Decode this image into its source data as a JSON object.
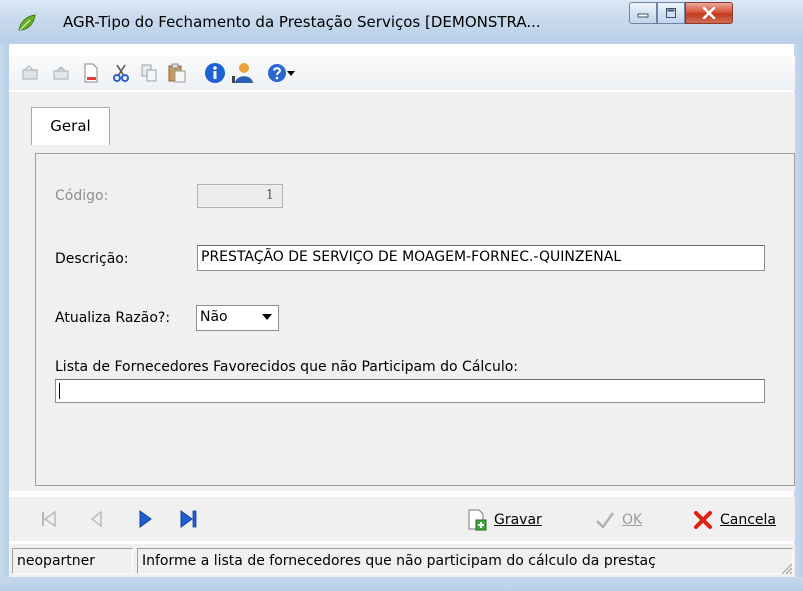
{
  "window": {
    "title": "AGR-Tipo do Fechamento da Prestação Serviços [DEMONSTRA..."
  },
  "toolbar": {
    "buttons": [
      "undo-icon",
      "redo-icon",
      "new-document-icon",
      "cut-icon",
      "copy-icon",
      "paste-icon",
      "info-icon",
      "user-icon",
      "help-icon"
    ]
  },
  "tabs": [
    {
      "label": "Geral",
      "active": true
    }
  ],
  "form": {
    "codigo_label": "Código:",
    "codigo_value": "1",
    "descricao_label": "Descrição:",
    "descricao_value": "PRESTAÇÃO DE SERVIÇO DE MOAGEM-FORNEC.-QUINZENAL",
    "atualiza_label": "Atualiza Razão?:",
    "atualiza_value": "Não",
    "lista_label": "Lista de Fornecedores Favorecidos que não Participam do Cálculo:",
    "lista_value": ""
  },
  "actions": {
    "gravar": "Gravar",
    "ok": "OK",
    "cancela": "Cancela"
  },
  "status": {
    "user": "neopartner",
    "message": "Informe a lista de fornecedores que não participam do cálculo da prestaç"
  },
  "colors": {
    "close_button": "#c03b20",
    "nav_arrow": "#1f5fd1",
    "cancel_x": "#e02010",
    "info_blue": "#1d62d6"
  }
}
